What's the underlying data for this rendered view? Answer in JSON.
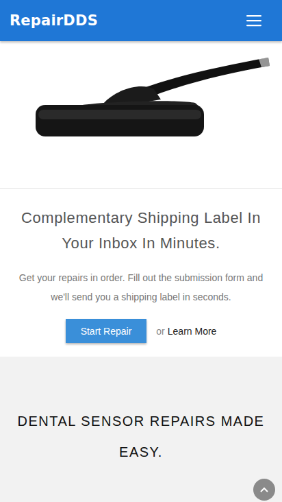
{
  "header": {
    "logo": "RepairDDS"
  },
  "hero": {
    "heading": "Complementary Shipping Label In Your Inbox In Minutes.",
    "text": "Get your repairs in order. Fill out the submission form and we'll send you a shipping label in seconds.",
    "primary_button": "Start Repair",
    "or_text": "or",
    "link": "Learn More"
  },
  "feature": {
    "heading": "DENTAL SENSOR REPAIRS MADE EASY."
  }
}
